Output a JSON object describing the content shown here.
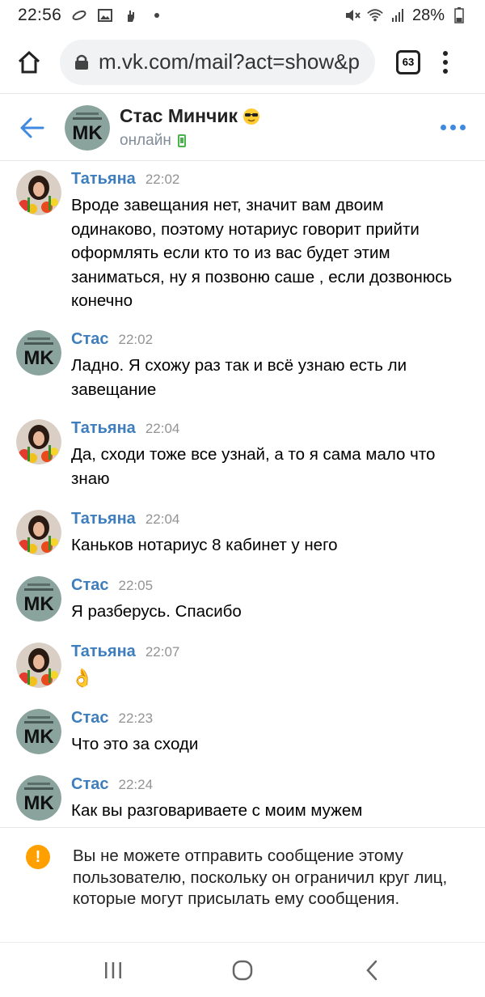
{
  "status_bar": {
    "time": "22:56",
    "battery": "28%",
    "icons": [
      "link-icon",
      "image-icon",
      "hand-icon",
      "dot-icon",
      "mute-icon",
      "wifi-icon",
      "signal-icon",
      "battery-icon"
    ]
  },
  "browser": {
    "url": "m.vk.com/mail?act=show&peer",
    "tab_count": "63"
  },
  "chat_header": {
    "name": "Стас Минчик",
    "status": "онлайн",
    "avatar_text": "MK"
  },
  "messages": [
    {
      "author": "Татьяна",
      "time": "22:02",
      "avatar": "tatyana",
      "text": "Вроде завещания нет, значит вам двоим одинаково, поэтому нотариус говорит прийти оформлять если кто то из вас будет этим заниматься, ну я позвоню саше , если дозвонюсь конечно"
    },
    {
      "author": "Стас",
      "time": "22:02",
      "avatar": "stas",
      "text": "Ладно. Я схожу раз так и всё узнаю есть ли завещание"
    },
    {
      "author": "Татьяна",
      "time": "22:04",
      "avatar": "tatyana",
      "text": "Да, сходи тоже все узнай, а то я сама мало что знаю"
    },
    {
      "author": "Татьяна",
      "time": "22:04",
      "avatar": "tatyana",
      "text": "Каньков нотариус 8 кабинет у него"
    },
    {
      "author": "Стас",
      "time": "22:05",
      "avatar": "stas",
      "text": "Я разберусь. Спасибо"
    },
    {
      "author": "Татьяна",
      "time": "22:07",
      "avatar": "tatyana",
      "text": "👌"
    },
    {
      "author": "Стас",
      "time": "22:23",
      "avatar": "stas",
      "text": "Что это за сходи"
    },
    {
      "author": "Стас",
      "time": "22:24",
      "avatar": "stas",
      "text": "Как вы разговариваете с моим мужем"
    }
  ],
  "notice": {
    "text": "Вы не можете отправить сообщение этому пользователю, поскольку он ограничил круг лиц, которые могут присылать ему сообщения."
  },
  "colors": {
    "accent": "#3f8ae0",
    "author": "#3f7ebd",
    "warning": "#ffa000",
    "online": "#4bb34b"
  }
}
